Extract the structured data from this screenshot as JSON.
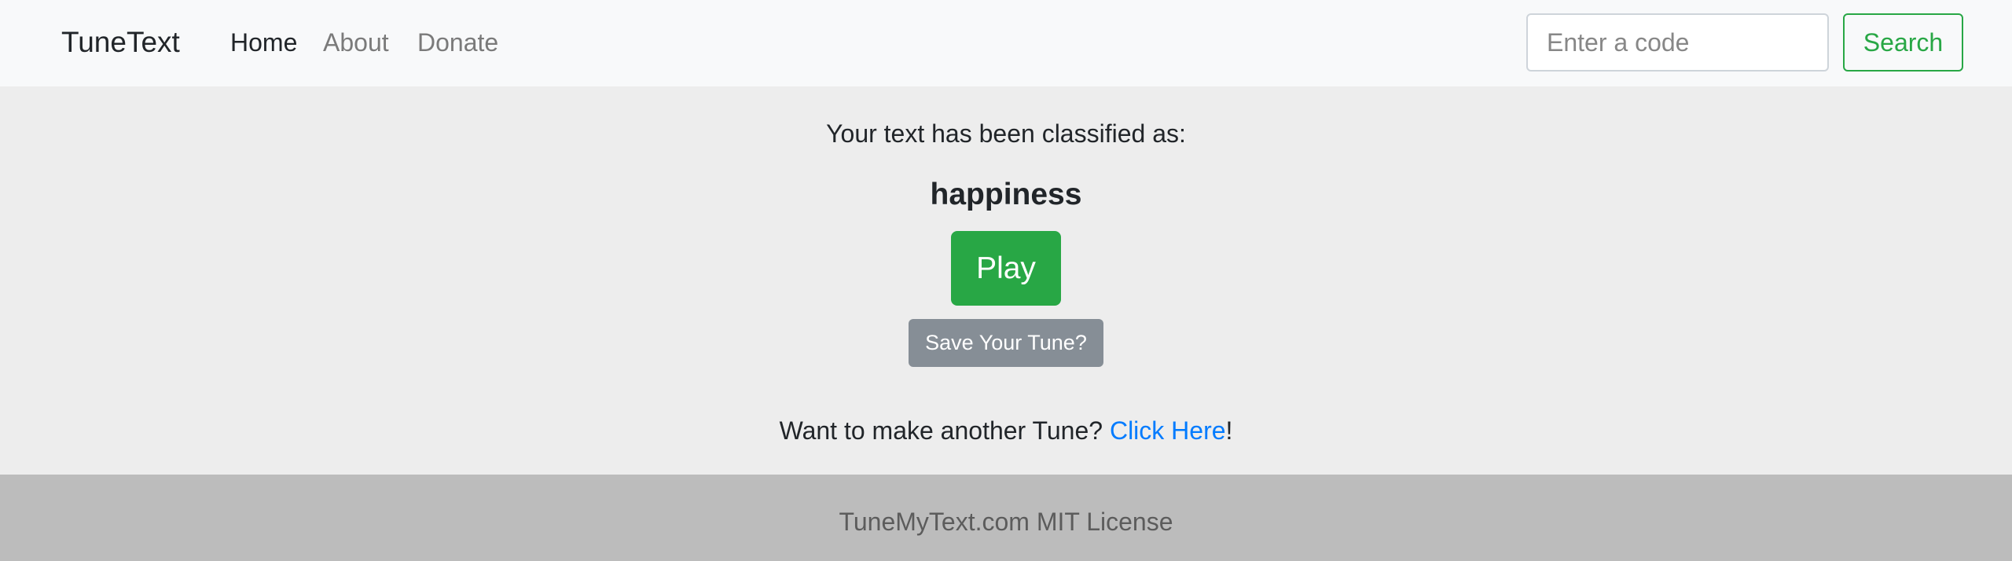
{
  "navbar": {
    "brand": "TuneText",
    "links": [
      {
        "label": "Home",
        "active": true
      },
      {
        "label": "About",
        "active": false
      },
      {
        "label": "Donate",
        "active": false
      }
    ],
    "search": {
      "placeholder": "Enter a code",
      "value": "",
      "button_label": "Search"
    }
  },
  "main": {
    "intro": "Your text has been classified as:",
    "emotion": "happiness",
    "play_label": "Play",
    "save_label": "Save Your Tune?",
    "another_prefix": "Want to make another Tune?",
    "another_link": "Click Here",
    "another_suffix": "!"
  },
  "footer": {
    "text": "TuneMyText.com MIT License"
  },
  "colors": {
    "accent_green": "#28a745",
    "link_blue": "#007bff",
    "secondary_gray": "#868e96",
    "navbar_bg": "#f8f9fa",
    "main_bg": "#ededed",
    "footer_bg": "#bcbcbc"
  }
}
